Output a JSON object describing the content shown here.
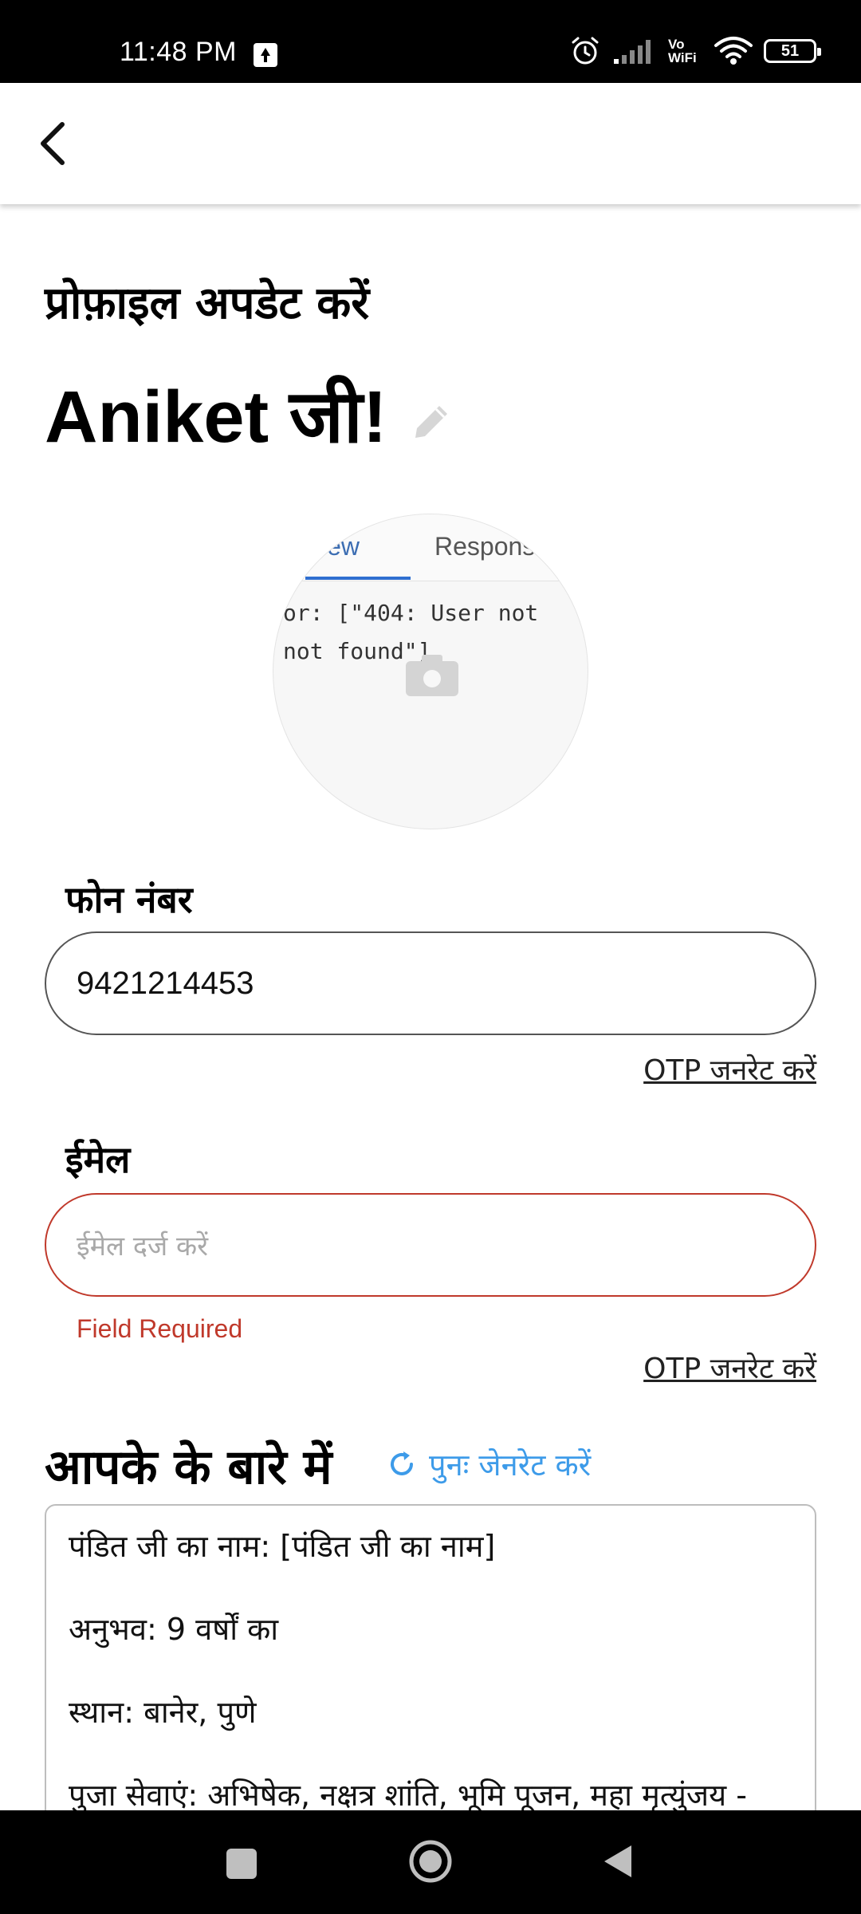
{
  "status_bar": {
    "time": "11:48 PM",
    "vo_wifi": "Vo WiFi",
    "battery": "51"
  },
  "header": {
    "back_icon": "chevron-left-icon"
  },
  "profile": {
    "title": "प्रोफ़ाइल अपडेट करें",
    "name": "Aniket  जी!",
    "edit_icon": "pencil-icon",
    "avatar": {
      "tab_preview": "view",
      "tab_response": "Respons",
      "code_line1": "or: [\"404: User not",
      "code_line2": "not found\"]",
      "camera_icon": "camera-icon"
    }
  },
  "phone": {
    "label": "फोन नंबर",
    "value": "9421214453",
    "otp_link": "OTP जनरेट करें"
  },
  "email": {
    "label": "ईमेल",
    "placeholder": "ईमेल दर्ज करें",
    "error": "Field Required",
    "otp_link": "OTP जनरेट करें"
  },
  "about": {
    "title": "आपके के बारे में",
    "regenerate_label": "पुनः जेनरेट करें",
    "lines": [
      "पंडित जी का नाम: [पंडित जी का नाम]",
      "अनुभव: 9 वर्षों का",
      "स्थान: बानेर, पुणे",
      "पुजा सेवाएं: अभिषेक, नक्षत्र शांति, भूमि पूजन, महा मृत्युंजय -"
    ]
  },
  "colors": {
    "error": "#c0392b",
    "link_blue": "#3d9be9"
  }
}
